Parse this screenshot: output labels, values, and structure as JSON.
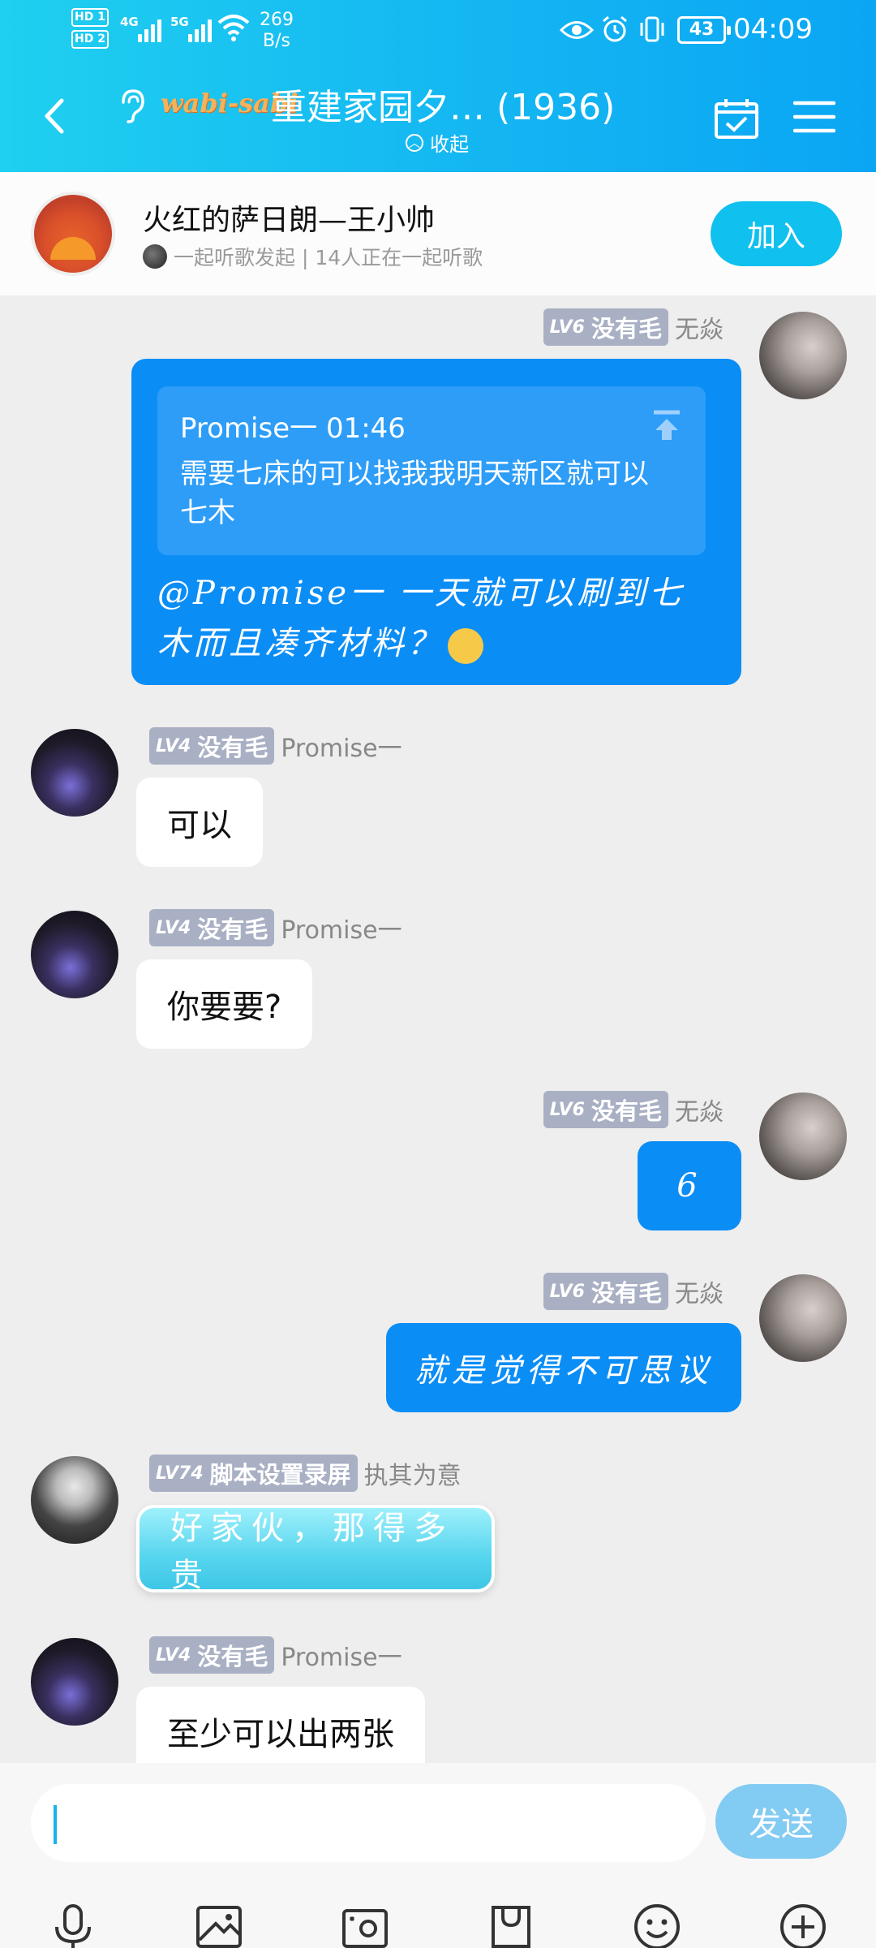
{
  "status_bar": {
    "hd1": "HD 1",
    "hd2": "HD 2",
    "net1": "4G",
    "net2": "5G",
    "speed_value": "269",
    "speed_unit": "B/s",
    "battery": "43",
    "time": "04:09"
  },
  "header": {
    "brand": "wabi-sabi",
    "title": "重建家园夕… (1936)",
    "collapse_label": "收起"
  },
  "listen_together": {
    "name": "火红的萨日朗—王小帅",
    "subtitle": "一起听歌发起 | 14人正在一起听歌",
    "join_label": "加入"
  },
  "messages": [
    {
      "level": "LV6",
      "tag": "没有毛",
      "sender": "无焱",
      "quote_header": "Promise一 01:46",
      "quote_body": "需要七床的可以找我我明天新区就可以七木",
      "text": "@Promise一 一天就可以刷到七木而且凑齐材料？"
    },
    {
      "level": "LV4",
      "tag": "没有毛",
      "sender": "Promise一",
      "text": "可以"
    },
    {
      "level": "LV4",
      "tag": "没有毛",
      "sender": "Promise一",
      "text": "你要要?"
    },
    {
      "level": "LV6",
      "tag": "没有毛",
      "sender": "无焱",
      "text": "6"
    },
    {
      "level": "LV6",
      "tag": "没有毛",
      "sender": "无焱",
      "text": "就是觉得不可思议"
    },
    {
      "level": "LV74",
      "tag": "脚本设置录屏",
      "sender": "执其为意",
      "text": "好家伙，那得多贵"
    },
    {
      "level": "LV4",
      "tag": "没有毛",
      "sender": "Promise一",
      "text": "至少可以出两张"
    }
  ],
  "input_bar": {
    "send_label": "发送",
    "placeholder": ""
  },
  "toolbar": [
    "microphone-icon",
    "image-icon",
    "camera-icon",
    "bag-icon",
    "emoji-icon",
    "plus-icon"
  ],
  "colors": {
    "header_gradient_start": "#1fd0f0",
    "header_gradient_end": "#0aa6f4",
    "outgoing_bubble": "#0b8df6",
    "join_button": "#10c0ee",
    "send_button": "#82cbf3"
  }
}
